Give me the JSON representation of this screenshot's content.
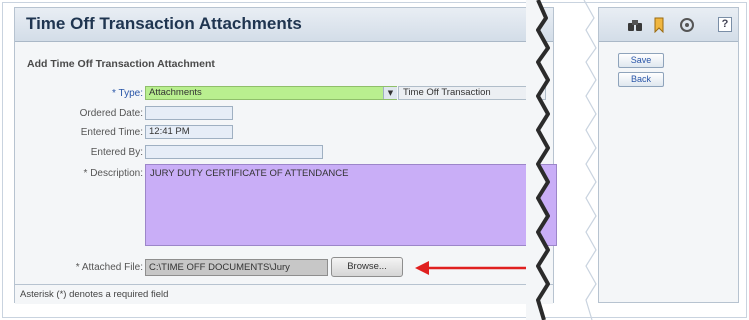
{
  "main": {
    "title": "Time Off Transaction Attachments",
    "section_title": "Add Time Off Transaction Attachment",
    "labels": {
      "type": "* Type:",
      "ordered_date": "Ordered Date:",
      "entered_time": "Entered Time:",
      "entered_by": "Entered By:",
      "description": "* Description:",
      "attached_file": "* Attached File:"
    },
    "fields": {
      "type_value": "Attachments",
      "type_context": "Time Off Transaction",
      "ordered_date": "",
      "entered_time": "12:41 PM",
      "entered_by": "",
      "description": "JURY DUTY CERTIFICATE OF ATTENDANCE",
      "attached_file": "C:\\TIME OFF DOCUMENTS\\Jury"
    },
    "browse_label": "Browse...",
    "footer_note": "Asterisk (*) denotes a required field"
  },
  "side": {
    "save_label": "Save",
    "back_label": "Back"
  },
  "colors": {
    "type_select_bg": "#b9ef8f",
    "description_bg": "#c9aef7",
    "pointer_arrow": "#e02020",
    "header_title": "#1f3550"
  },
  "icons": [
    "binoculars-icon",
    "bookmark-icon",
    "shield-icon",
    "help-icon"
  ]
}
